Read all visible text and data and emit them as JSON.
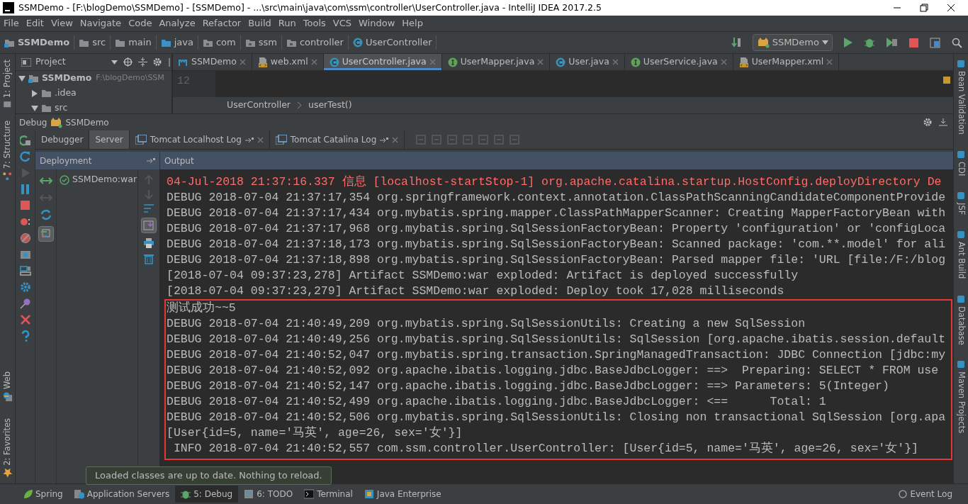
{
  "window": {
    "title": "SSMDemo - [F:\\blogDemo\\SSMDemo] - [SSMDemo] - ...\\src\\main\\java\\com\\ssm\\controller\\UserController.java - IntelliJ IDEA 2017.2.5"
  },
  "menu": [
    "File",
    "Edit",
    "View",
    "Navigate",
    "Code",
    "Analyze",
    "Refactor",
    "Build",
    "Run",
    "Tools",
    "VCS",
    "Window",
    "Help"
  ],
  "breadcrumb": [
    {
      "label": "SSMDemo",
      "kind": "module"
    },
    {
      "label": "src",
      "kind": "folder"
    },
    {
      "label": "main",
      "kind": "folder"
    },
    {
      "label": "java",
      "kind": "source"
    },
    {
      "label": "com",
      "kind": "package"
    },
    {
      "label": "ssm",
      "kind": "package"
    },
    {
      "label": "controller",
      "kind": "package"
    },
    {
      "label": "UserController",
      "kind": "class"
    }
  ],
  "run_config": {
    "label": "SSMDemo"
  },
  "left_stripe": {
    "top": [
      "1: Project",
      "7: Structure"
    ],
    "bottom": [
      "Web",
      "2: Favorites"
    ]
  },
  "project_panel": {
    "title": "Project",
    "tree": [
      {
        "label": "SSMDemo",
        "path": "F:\\blogDemo\\SSM",
        "expanded": true,
        "children": [
          {
            "label": ".idea",
            "expanded": false
          },
          {
            "label": "src",
            "expanded": true
          }
        ]
      }
    ]
  },
  "editor_tabs": [
    {
      "label": "SSMDemo",
      "kind": "module",
      "selected": false
    },
    {
      "label": "web.xml",
      "kind": "xml",
      "selected": false
    },
    {
      "label": "UserController.java",
      "kind": "class",
      "selected": true
    },
    {
      "label": "UserMapper.java",
      "kind": "interface",
      "selected": false
    },
    {
      "label": "User.java",
      "kind": "class",
      "selected": false
    },
    {
      "label": "UserService.java",
      "kind": "interface",
      "selected": false
    },
    {
      "label": "UserMapper.xml",
      "kind": "xml",
      "selected": false
    }
  ],
  "editor": {
    "line_numbers": [
      "12"
    ],
    "breadcrumb": [
      "UserController",
      "userTest()"
    ]
  },
  "right_stripe": [
    "Bean Validation",
    "CDI",
    "JSF",
    "Ant Build",
    "Database",
    "Maven Projects"
  ],
  "debug": {
    "title": "Debug",
    "config": "SSMDemo",
    "tabs": [
      {
        "label": "Debugger",
        "kind": "plain",
        "selected": false
      },
      {
        "label": "Server",
        "kind": "plain",
        "selected": true
      },
      {
        "label": "Tomcat Localhost Log",
        "kind": "log",
        "selected": false
      },
      {
        "label": "Tomcat Catalina Log",
        "kind": "log",
        "selected": false
      }
    ],
    "deployment": {
      "title": "Deployment",
      "items": [
        "SSMDemo:war"
      ]
    },
    "output_title": "Output",
    "console": {
      "lines": [
        {
          "text": "04-Jul-2018 21:37:16.337 信息 [localhost-startStop-1] org.apache.catalina.startup.HostConfig.deployDirectory De",
          "kind": "error"
        },
        {
          "text": "DEBUG 2018-07-04 21:37:17,354 org.springframework.context.annotation.ClassPathScanningCandidateComponentProvide",
          "kind": "normal"
        },
        {
          "text": "DEBUG 2018-07-04 21:37:17,434 org.mybatis.spring.mapper.ClassPathMapperScanner: Creating MapperFactoryBean with",
          "kind": "normal"
        },
        {
          "text": "DEBUG 2018-07-04 21:37:17,968 org.mybatis.spring.SqlSessionFactoryBean: Property 'configuration' or 'configLoca",
          "kind": "normal"
        },
        {
          "text": "DEBUG 2018-07-04 21:37:18,173 org.mybatis.spring.SqlSessionFactoryBean: Scanned package: 'com.**.model' for ali",
          "kind": "normal"
        },
        {
          "text": "DEBUG 2018-07-04 21:37:18,898 org.mybatis.spring.SqlSessionFactoryBean: Parsed mapper file: 'URL [file:/F:/blog",
          "kind": "normal"
        },
        {
          "text": "[2018-07-04 09:37:23,278] Artifact SSMDemo:war exploded: Artifact is deployed successfully",
          "kind": "normal"
        },
        {
          "text": "[2018-07-04 09:37:23,279] Artifact SSMDemo:war exploded: Deploy took 17,028 milliseconds",
          "kind": "normal"
        }
      ],
      "highlighted_lines": [
        "测试成功~~5",
        "DEBUG 2018-07-04 21:40:49,209 org.mybatis.spring.SqlSessionUtils: Creating a new SqlSession",
        "DEBUG 2018-07-04 21:40:49,256 org.mybatis.spring.SqlSessionUtils: SqlSession [org.apache.ibatis.session.default",
        "DEBUG 2018-07-04 21:40:52,047 org.mybatis.spring.transaction.SpringManagedTransaction: JDBC Connection [jdbc:my",
        "DEBUG 2018-07-04 21:40:52,092 org.apache.ibatis.logging.jdbc.BaseJdbcLogger: ==>  Preparing: SELECT * FROM use",
        "DEBUG 2018-07-04 21:40:52,147 org.apache.ibatis.logging.jdbc.BaseJdbcLogger: ==> Parameters: 5(Integer)",
        "DEBUG 2018-07-04 21:40:52,499 org.apache.ibatis.logging.jdbc.BaseJdbcLogger: <==      Total: 1",
        "DEBUG 2018-07-04 21:40:52,506 org.mybatis.spring.SqlSessionUtils: Closing non transactional SqlSession [org.apa",
        "[User{id=5, name='马英', age=26, sex='女'}]",
        " INFO 2018-07-04 21:40:52,557 com.ssm.controller.UserController: [User{id=5, name='马英', age=26, sex='女'}]"
      ]
    }
  },
  "tooltip": "Loaded classes are up to date. Nothing to reload.",
  "bottom_tabs": [
    {
      "label": "Spring",
      "kind": "spring",
      "selected": false
    },
    {
      "label": "Application Servers",
      "kind": "servers",
      "selected": false
    },
    {
      "label": "5: Debug",
      "kind": "debug",
      "selected": true
    },
    {
      "label": "6: TODO",
      "kind": "todo",
      "selected": false
    },
    {
      "label": "Terminal",
      "kind": "terminal",
      "selected": false
    },
    {
      "label": "Java Enterprise",
      "kind": "enterprise",
      "selected": false
    }
  ],
  "event_log": "Event Log"
}
